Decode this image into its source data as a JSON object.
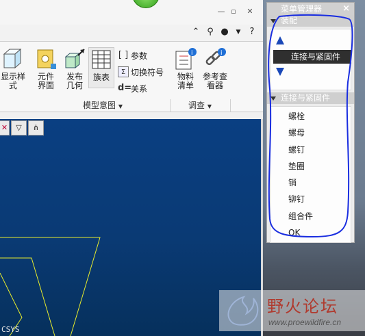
{
  "ribbon": {
    "display_style": "显示样\n式",
    "component_interface": "元件\n界面",
    "publish_geometry": "发布\n几何",
    "family_table": "族表",
    "parameters": "参数",
    "switch_symbols": "切换符号",
    "relations": "关系",
    "bom": "物料\n清单",
    "reference_viewer": "参考查\n看器",
    "group_model_intent": "模型意图",
    "group_investigate": "调查"
  },
  "viewport": {
    "csys_label": "CSYS"
  },
  "menu_manager": {
    "title": "菜单管理器",
    "close": "×",
    "section1_header": "装配",
    "selected_item": "连接与紧固件",
    "section2_header": "连接与紧固件",
    "items": [
      "螺栓",
      "螺母",
      "螺钉",
      "垫圈",
      "销",
      "铆钉",
      "组合件",
      "OK"
    ]
  },
  "watermark": {
    "title": "野火论坛",
    "url": "www.proewildfire.cn"
  },
  "colors": {
    "viewport_top": "#0a3f82",
    "selection": "#2f2f2f",
    "annotation": "#1a2ee0",
    "arrow": "#1a48b8"
  }
}
